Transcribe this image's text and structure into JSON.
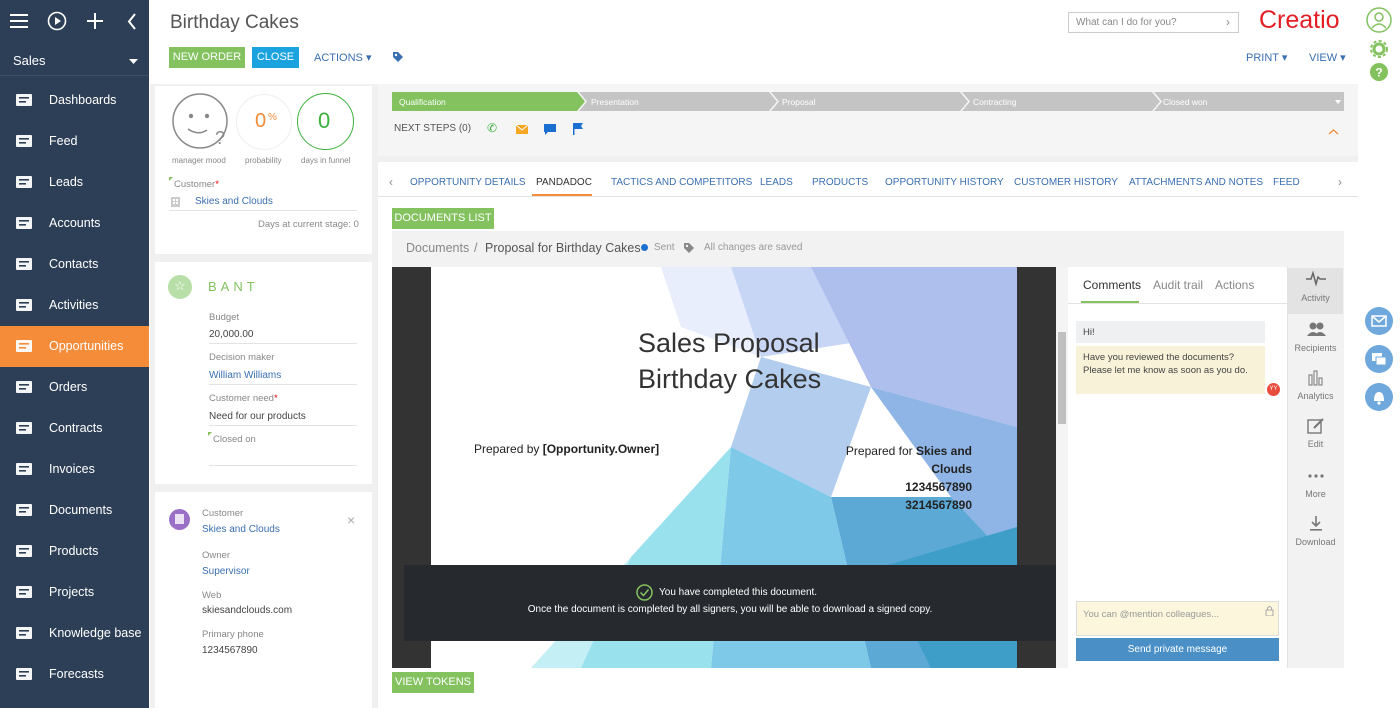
{
  "app": {
    "section": "Sales",
    "logo": "Creatio"
  },
  "nav": [
    {
      "label": "Dashboards",
      "icon": "dashboards-icon",
      "active": false
    },
    {
      "label": "Feed",
      "icon": "feed-icon",
      "active": false
    },
    {
      "label": "Leads",
      "icon": "leads-icon",
      "active": false
    },
    {
      "label": "Accounts",
      "icon": "accounts-icon",
      "active": false
    },
    {
      "label": "Contacts",
      "icon": "contacts-icon",
      "active": false
    },
    {
      "label": "Activities",
      "icon": "activities-icon",
      "active": false
    },
    {
      "label": "Opportunities",
      "icon": "opportunities-icon",
      "active": true
    },
    {
      "label": "Orders",
      "icon": "orders-icon",
      "active": false
    },
    {
      "label": "Contracts",
      "icon": "contracts-icon",
      "active": false
    },
    {
      "label": "Invoices",
      "icon": "invoices-icon",
      "active": false
    },
    {
      "label": "Documents",
      "icon": "documents-icon",
      "active": false
    },
    {
      "label": "Products",
      "icon": "products-icon",
      "active": false
    },
    {
      "label": "Projects",
      "icon": "projects-icon",
      "active": false
    },
    {
      "label": "Knowledge base",
      "icon": "knowledge-base-icon",
      "active": false
    },
    {
      "label": "Forecasts",
      "icon": "forecasts-icon",
      "active": false
    }
  ],
  "header": {
    "title": "Birthday Cakes",
    "new_order": "NEW ORDER",
    "close": "CLOSE",
    "actions": "ACTIONS",
    "search_placeholder": "What can I do for you?",
    "print": "PRINT",
    "view": "VIEW"
  },
  "metrics": {
    "mood_label": "manager mood",
    "probability_value": "0",
    "probability_unit": "%",
    "probability_label": "probability",
    "days_value": "0",
    "days_label": "days in funnel"
  },
  "customer_box": {
    "label": "Customer",
    "value": "Skies and Clouds",
    "days_stage_label": "Days at current stage:",
    "days_stage_value": "0"
  },
  "bant": {
    "title": "BANT",
    "budget_label": "Budget",
    "budget_value": "20,000.00",
    "decision_label": "Decision maker",
    "decision_value": "William Williams",
    "need_label": "Customer need",
    "need_value": "Need for our products",
    "closed_label": "Closed on"
  },
  "contact_card": {
    "customer_label": "Customer",
    "customer_value": "Skies and Clouds",
    "owner_label": "Owner",
    "owner_value": "Supervisor",
    "web_label": "Web",
    "web_value": "skiesandclouds.com",
    "phone_label": "Primary phone",
    "phone_value": "1234567890"
  },
  "stages": [
    "Qualification",
    "Presentation",
    "Proposal",
    "Contracting",
    "Closed won"
  ],
  "next_steps": "NEXT STEPS (0)",
  "tabs": [
    "OPPORTUNITY DETAILS",
    "PANDADOC",
    "TACTICS AND COMPETITORS",
    "LEADS",
    "PRODUCTS",
    "OPPORTUNITY HISTORY",
    "CUSTOMER HISTORY",
    "ATTACHMENTS AND NOTES",
    "FEED"
  ],
  "docs": {
    "list_button": "DOCUMENTS LIST",
    "breadcrumb_root": "Documents",
    "breadcrumb_sep": "/",
    "breadcrumb_doc": "Proposal for Birthday Cakes",
    "status": "Sent",
    "saved": "All changes are saved",
    "tokens_button": "VIEW TOKENS"
  },
  "proposal": {
    "title_line1": "Sales Proposal",
    "title_line2": "Birthday Cakes",
    "prepared_by_label": "Prepared by",
    "prepared_by_value": "[Opportunity.Owner]",
    "prepared_for_label": "Prepared for",
    "prepared_for_value": "Skies and Clouds",
    "phone1": "1234567890",
    "phone2": "3214567890"
  },
  "completed": {
    "line1": "You have completed this document.",
    "line2": "Once the document is completed by all signers, you will be able to download a signed copy."
  },
  "comments": {
    "tabs": [
      "Comments",
      "Audit trail",
      "Actions"
    ],
    "msg1": "Hi!",
    "msg2": "Have you reviewed the documents? Please let me know as soon as you do.",
    "avatar": "YY",
    "input_placeholder": "You can @mention colleagues...",
    "send": "Send private message"
  },
  "right_tools": [
    "Activity",
    "Recipients",
    "Analytics",
    "Edit",
    "More",
    "Download"
  ],
  "colors": {
    "sidebar": "#2d3f56",
    "accent": "#f58c3a",
    "green": "#83c25f",
    "blue": "#1ba3e0",
    "link": "#3a6fb0"
  }
}
